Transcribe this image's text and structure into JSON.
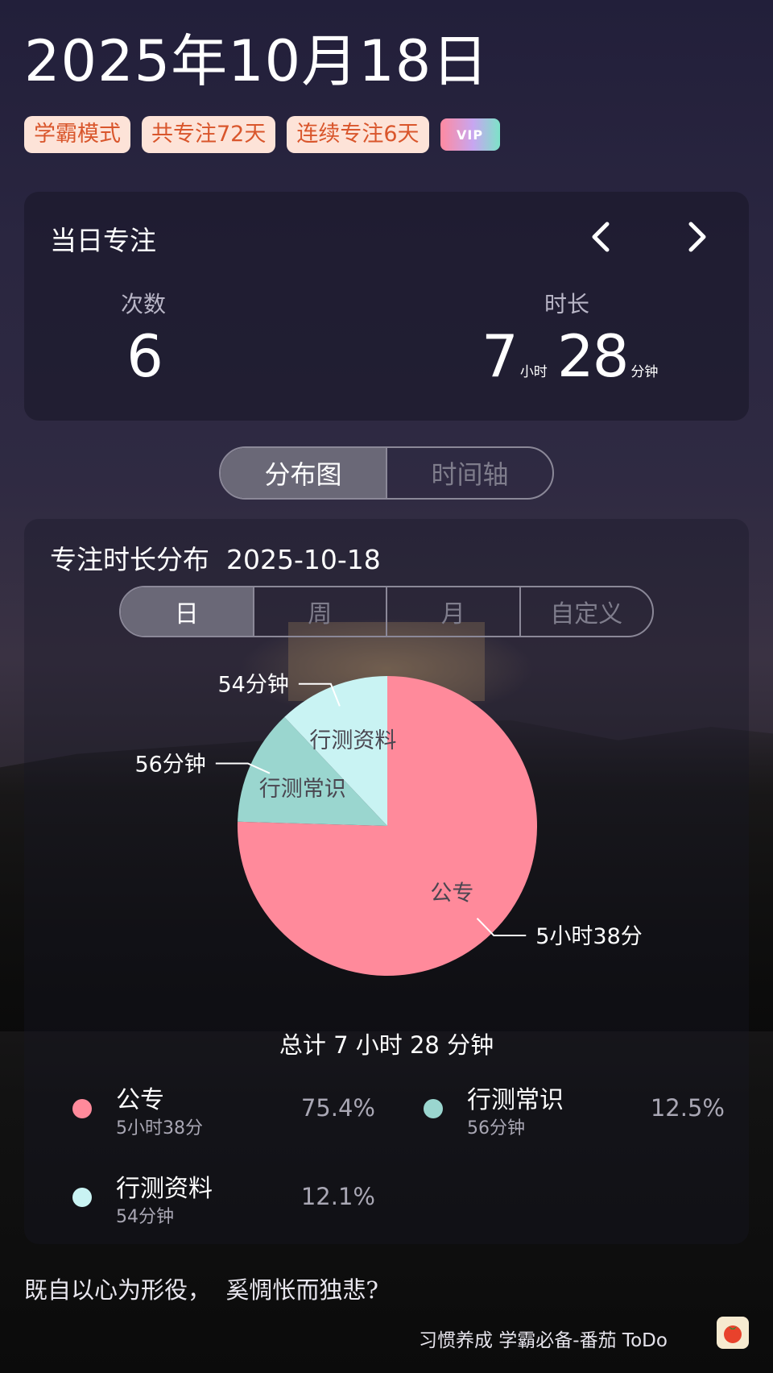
{
  "header": {
    "date": "2025年10月18日",
    "tags": [
      "学霸模式",
      "共专注72天",
      "连续专注6天"
    ],
    "vip_label": "VIP"
  },
  "focus_card": {
    "title": "当日专注",
    "count_label": "次数",
    "count_value": "6",
    "duration_label": "时长",
    "duration_hours": "7",
    "hours_unit": "小时",
    "duration_minutes": "28",
    "minutes_unit": "分钟"
  },
  "view_tabs": [
    "分布图",
    "时间轴"
  ],
  "distribution": {
    "title": "专注时长分布",
    "date": "2025-10-18",
    "period_tabs": [
      "日",
      "周",
      "月",
      "自定义"
    ],
    "total": "总计 7 小时 28 分钟"
  },
  "chart_data": {
    "type": "pie",
    "slices": [
      {
        "label": "公专",
        "value": 338,
        "display": "5小时38分",
        "percent": "75.4%",
        "color": "#ff8a9b"
      },
      {
        "label": "行测常识",
        "value": 56,
        "display": "56分钟",
        "percent": "12.5%",
        "color": "#9ad6cf"
      },
      {
        "label": "行测资料",
        "value": 54,
        "display": "54分钟",
        "percent": "12.1%",
        "color": "#c9f3f3"
      }
    ]
  },
  "footer": {
    "quote": "既自以心为形役，  奚惆怅而独悲?",
    "app_text": "习惯养成 学霸必备-番茄 ToDo"
  }
}
